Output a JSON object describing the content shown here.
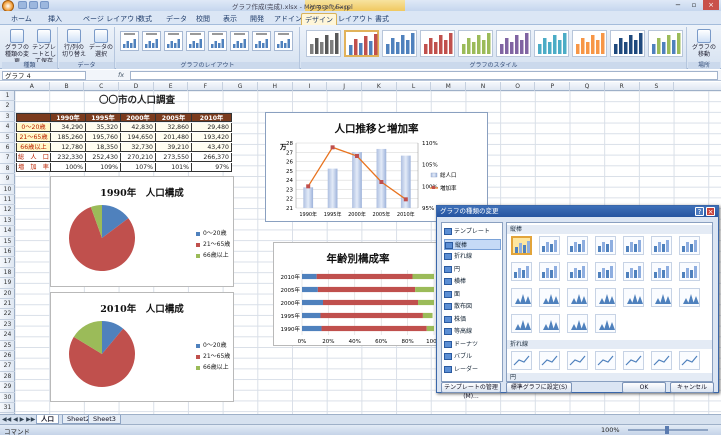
{
  "window": {
    "title": "グラフ作成(完成).xlsx - Microsoft Excel",
    "tool_context": "グラフ ツール",
    "minimize": "−",
    "restore": "▫",
    "close": "×"
  },
  "tabs": [
    "ホーム",
    "挿入",
    "ページ レイアウト",
    "数式",
    "データ",
    "校閲",
    "表示",
    "開発",
    "アドイン",
    "デザイン",
    "レイアウト",
    "書式"
  ],
  "active_tab": "デザイン",
  "ribbon": {
    "group_type": {
      "label": "種類",
      "buttons": [
        "グラフの種類の変更",
        "テンプレートとして保存"
      ]
    },
    "group_data": {
      "label": "データ",
      "buttons": [
        "行/列の切り替え",
        "データの選択"
      ]
    },
    "group_layout": {
      "label": "グラフのレイアウト"
    },
    "group_styles": {
      "label": "グラフのスタイル"
    },
    "group_location": {
      "label": "場所",
      "buttons": [
        "グラフの移動"
      ]
    }
  },
  "namebox": "グラフ 4",
  "fx": "fx",
  "columns": [
    "A",
    "B",
    "C",
    "D",
    "E",
    "F",
    "G",
    "H",
    "I",
    "J",
    "K",
    "L",
    "M",
    "N",
    "O",
    "P",
    "Q",
    "R",
    "S"
  ],
  "rows": [
    "1",
    "2",
    "3",
    "4",
    "5",
    "6",
    "7",
    "8",
    "9",
    "10",
    "11",
    "12",
    "13",
    "14",
    "15",
    "16",
    "17",
    "18",
    "19",
    "20",
    "21",
    "22",
    "23",
    "24",
    "25",
    "26",
    "27",
    "28",
    "29",
    "30",
    "31"
  ],
  "table": {
    "title": "〇〇市の人口調査",
    "headers": [
      "",
      "1990年",
      "1995年",
      "2000年",
      "2005年",
      "2010年"
    ],
    "rows": [
      {
        "label": "0～20歳",
        "values": [
          "34,290",
          "35,320",
          "42,830",
          "32,860",
          "29,480"
        ]
      },
      {
        "label": "21～65歳",
        "values": [
          "185,260",
          "195,760",
          "194,650",
          "201,480",
          "193,420"
        ]
      },
      {
        "label": "66歳以上",
        "values": [
          "12,780",
          "18,350",
          "32,730",
          "39,210",
          "43,470"
        ]
      },
      {
        "label": "総　人　口",
        "values": [
          "232,330",
          "252,430",
          "270,210",
          "273,550",
          "266,370"
        ]
      },
      {
        "label": "増　加　率",
        "values": [
          "100%",
          "109%",
          "107%",
          "101%",
          "97%"
        ]
      }
    ]
  },
  "charts": {
    "pie1990": {
      "title": "1990年　人口構成",
      "legend": [
        "0～20歳",
        "21～65歳",
        "66歳以上"
      ]
    },
    "pie2010": {
      "title": "2010年　人口構成",
      "legend": [
        "0～20歳",
        "21～65歳",
        "66歳以上"
      ]
    },
    "combo": {
      "title": "人口推移と増加率",
      "unit": "万",
      "legend": [
        "総人口",
        "増加率"
      ],
      "yleft": [
        "21",
        "22",
        "23",
        "24",
        "25",
        "26",
        "27",
        "28"
      ],
      "yright": [
        "95%",
        "100%",
        "105%",
        "110%"
      ]
    },
    "bar": {
      "title": "年齢別構成率",
      "xticks": [
        "0%",
        "20%",
        "40%",
        "60%",
        "80%",
        "100%"
      ]
    }
  },
  "chart_data": [
    {
      "type": "pie",
      "title": "1990年　人口構成",
      "categories": [
        "0～20歳",
        "21～65歳",
        "66歳以上"
      ],
      "values": [
        34290,
        185260,
        12780
      ],
      "colors": [
        "#4f81bd",
        "#c0504d",
        "#9bbb59"
      ]
    },
    {
      "type": "pie",
      "title": "2010年　人口構成",
      "categories": [
        "0～20歳",
        "21～65歳",
        "66歳以上"
      ],
      "values": [
        29480,
        193420,
        43470
      ],
      "colors": [
        "#4f81bd",
        "#c0504d",
        "#9bbb59"
      ]
    },
    {
      "type": "bar",
      "title": "人口推移と増加率",
      "categories": [
        "1990年",
        "1995年",
        "2000年",
        "2005年",
        "2010年"
      ],
      "series": [
        {
          "name": "総人口",
          "values": [
            23.23,
            25.24,
            27.02,
            27.36,
            26.64
          ]
        },
        {
          "name": "増加率",
          "values": [
            100,
            109,
            107,
            101,
            97
          ]
        }
      ],
      "ylabel": "万",
      "ylim": [
        21,
        28
      ],
      "y2lim": [
        95,
        110
      ]
    },
    {
      "type": "bar",
      "title": "年齢別構成率",
      "categories": [
        "1990年",
        "1995年",
        "2000年",
        "2005年",
        "2010年"
      ],
      "series": [
        {
          "values": [
            14.8,
            14.0,
            15.9,
            12.0,
            11.1
          ]
        },
        {
          "values": [
            79.7,
            77.6,
            72.0,
            73.7,
            72.6
          ]
        },
        {
          "values": [
            5.5,
            7.3,
            12.1,
            14.3,
            16.3
          ]
        }
      ],
      "xlim": [
        0,
        100
      ],
      "colors": [
        "#4f81bd",
        "#c0504d",
        "#9bbb59"
      ]
    }
  ],
  "dialog": {
    "title": "グラフの種類の変更",
    "categories": [
      "テンプレート",
      "縦棒",
      "折れ線",
      "円",
      "横棒",
      "面",
      "散布図",
      "株価",
      "等高線",
      "ドーナツ",
      "バブル",
      "レーダー"
    ],
    "selected": "縦棒",
    "sections": [
      "縦棒",
      "折れ線",
      "円"
    ],
    "buttons": {
      "manage": "テンプレートの管理(M)...",
      "set_default": "標準グラフに設定(S)",
      "ok": "OK",
      "cancel": "キャンセル"
    }
  },
  "sheets": [
    "人口",
    "Sheet2",
    "Sheet3"
  ],
  "active_sheet": "人口",
  "status": {
    "mode": "コマンド",
    "zoom": "100%"
  }
}
